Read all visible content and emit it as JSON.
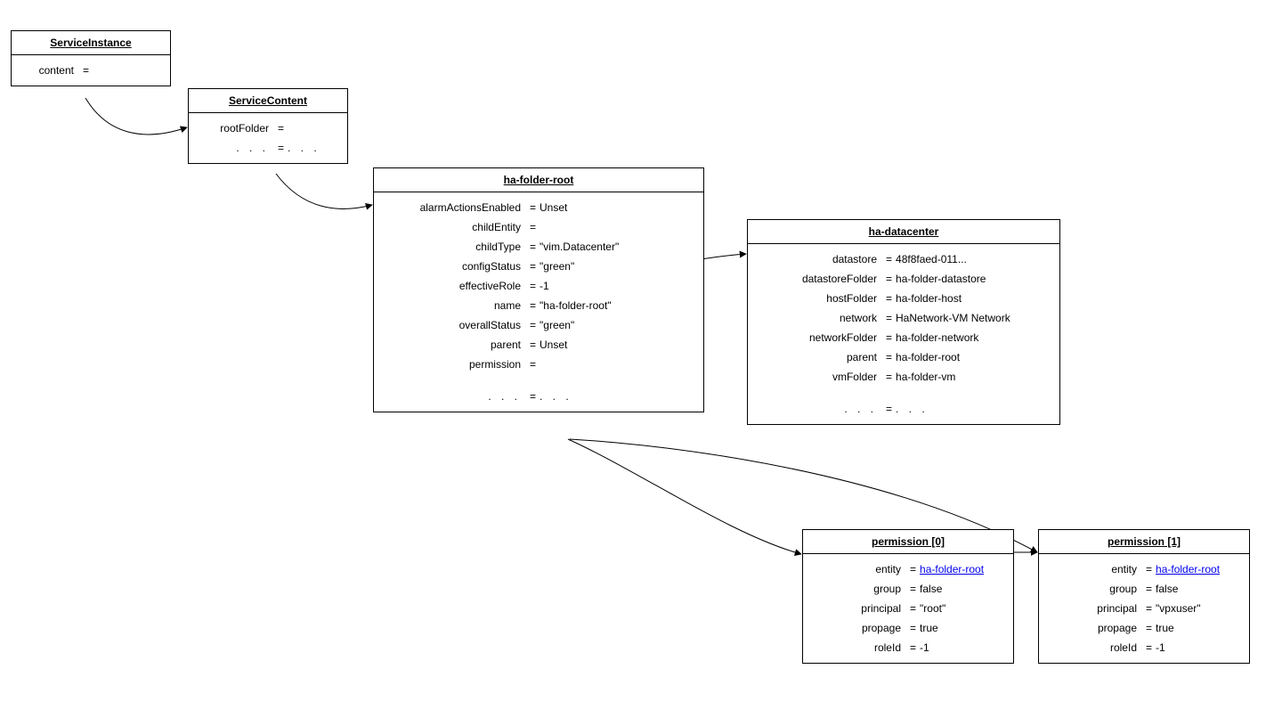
{
  "serviceInstance": {
    "title": "ServiceInstance",
    "content_key": "content"
  },
  "serviceContent": {
    "title": "ServiceContent",
    "rootFolder_key": "rootFolder",
    "ell_key": ".  .  .",
    "ell_val": ".  .  ."
  },
  "haFolderRoot": {
    "title": "ha-folder-root",
    "rows": [
      {
        "k": "alarmActionsEnabled",
        "v": "Unset"
      },
      {
        "k": "childEntity",
        "v": ""
      },
      {
        "k": "childType",
        "v": "\"vim.Datacenter\""
      },
      {
        "k": "configStatus",
        "v": "\"green\""
      },
      {
        "k": "effectiveRole",
        "v": "-1"
      },
      {
        "k": "name",
        "v": "\"ha-folder-root\""
      },
      {
        "k": "overallStatus",
        "v": "\"green\""
      },
      {
        "k": "parent",
        "v": "Unset"
      },
      {
        "k": "permission",
        "v": ""
      }
    ],
    "ell_key": ".  .  .",
    "ell_val": ".  .  ."
  },
  "haDatacenter": {
    "title": "ha-datacenter",
    "rows": [
      {
        "k": "datastore",
        "v": "48f8faed-011..."
      },
      {
        "k": "datastoreFolder",
        "v": "ha-folder-datastore"
      },
      {
        "k": "hostFolder",
        "v": "ha-folder-host"
      },
      {
        "k": "network",
        "v": "HaNetwork-VM Network"
      },
      {
        "k": "networkFolder",
        "v": "ha-folder-network"
      },
      {
        "k": "parent",
        "v": "ha-folder-root"
      },
      {
        "k": "vmFolder",
        "v": "ha-folder-vm"
      }
    ],
    "ell_key": ".  .  .",
    "ell_val": ".  .  ."
  },
  "permission0": {
    "title": "permission [0]",
    "rows": [
      {
        "k": "entity",
        "v": "ha-folder-root",
        "link": true
      },
      {
        "k": "group",
        "v": "false"
      },
      {
        "k": "principal",
        "v": "\"root\""
      },
      {
        "k": "propage",
        "v": "true"
      },
      {
        "k": "roleId",
        "v": "-1"
      }
    ]
  },
  "permission1": {
    "title": "permission [1]",
    "rows": [
      {
        "k": "entity",
        "v": "ha-folder-root",
        "link": true
      },
      {
        "k": "group",
        "v": "false"
      },
      {
        "k": "principal",
        "v": "\"vpxuser\""
      },
      {
        "k": "propage",
        "v": "true"
      },
      {
        "k": "roleId",
        "v": "-1"
      }
    ]
  }
}
